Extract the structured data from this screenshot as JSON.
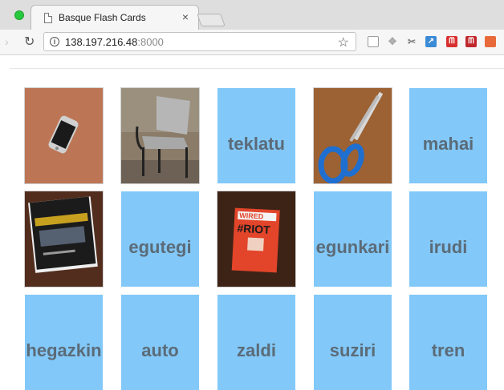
{
  "browser": {
    "tab_title": "Basque Flash Cards",
    "tab_close": "×",
    "url_host": "138.197.216.48",
    "url_port": ":8000"
  },
  "cards": {
    "c1": {
      "kind": "photo",
      "icon": "phone-photo"
    },
    "c2": {
      "kind": "photo",
      "icon": "chair-photo"
    },
    "c3": {
      "kind": "word",
      "label": "teklatu"
    },
    "c4": {
      "kind": "photo",
      "icon": "scissors-photo"
    },
    "c5": {
      "kind": "word",
      "label": "mahai"
    },
    "c6": {
      "kind": "photo",
      "icon": "book-photo"
    },
    "c7": {
      "kind": "word",
      "label": "egutegi"
    },
    "c8": {
      "kind": "photo",
      "icon": "magazine-photo",
      "text": "WIRED #RIOT"
    },
    "c9": {
      "kind": "word",
      "label": "egunkari"
    },
    "c10": {
      "kind": "word",
      "label": "irudi"
    },
    "c11": {
      "kind": "word",
      "label": "hegazkin"
    },
    "c12": {
      "kind": "word",
      "label": "auto"
    },
    "c13": {
      "kind": "word",
      "label": "zaldi"
    },
    "c14": {
      "kind": "word",
      "label": "suziri"
    },
    "c15": {
      "kind": "word",
      "label": "tren"
    }
  },
  "colors": {
    "card_blue": "#82c8f8",
    "card_text": "#5b6b78"
  }
}
